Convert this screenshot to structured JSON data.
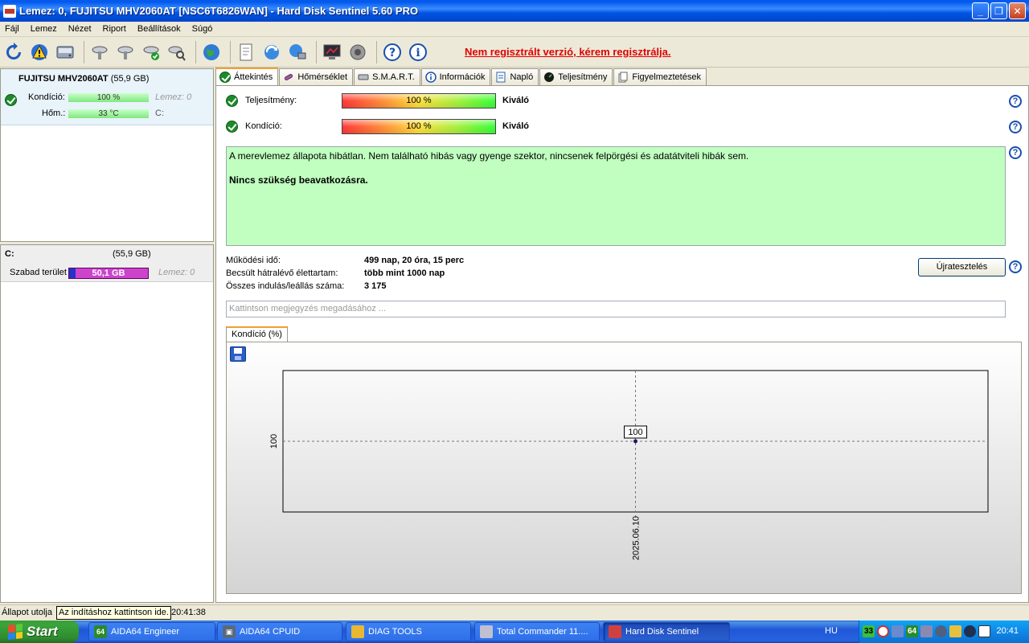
{
  "window": {
    "title": "Lemez: 0, FUJITSU MHV2060AT [NSC6T6826WAN]  -  Hard Disk Sentinel 5.60 PRO",
    "min": "_",
    "max": "❐",
    "close": "✕"
  },
  "menu": [
    "Fájl",
    "Lemez",
    "Nézet",
    "Riport",
    "Beállítások",
    "Súgó"
  ],
  "toolbar": {
    "icons": [
      "refresh-icon",
      "alert-icon",
      "disk-icon",
      "disk-test-icon",
      "disk-surface-icon",
      "disk-ok-icon",
      "disk-search-icon",
      "globe-icon",
      "report-icon",
      "update-icon",
      "network-icon",
      "monitor-icon",
      "speaker-icon",
      "help-icon",
      "info-icon"
    ],
    "unregistered": "Nem regisztrált verzió, kérem regisztrálja."
  },
  "disk": {
    "name": "FUJITSU MHV2060AT",
    "size": "(55,9 GB)",
    "condition_label": "Kondíció:",
    "condition_value": "100 %",
    "condition_pct": 100,
    "disk_label": "Lemez: 0",
    "temp_label": "Hőm.:",
    "temp_value": "33 °C",
    "drive": "C:"
  },
  "volume": {
    "name": "C:",
    "size": "(55,9 GB)",
    "free_label": "Szabad terület",
    "free_value": "50,1 GB",
    "disk_label": "Lemez: 0"
  },
  "tabs": [
    {
      "label": "Áttekintés",
      "icon": "ok-icon",
      "active": true
    },
    {
      "label": "Hőmérséklet",
      "icon": "thermometer-icon",
      "active": false
    },
    {
      "label": "S.M.A.R.T.",
      "icon": "smart-icon",
      "active": false
    },
    {
      "label": "Információk",
      "icon": "info-icon",
      "active": false
    },
    {
      "label": "Napló",
      "icon": "log-icon",
      "active": false
    },
    {
      "label": "Teljesítmény",
      "icon": "performance-icon",
      "active": false
    },
    {
      "label": "Figyelmeztetések",
      "icon": "warnings-icon",
      "active": false
    }
  ],
  "overview": {
    "performance_label": "Teljesítmény:",
    "performance_value": "100 %",
    "performance_verdict": "Kiváló",
    "health_label": "Kondíció:",
    "health_value": "100 %",
    "health_verdict": "Kiváló",
    "status_text": "A merevlemez állapota hibátlan. Nem található hibás vagy gyenge szektor, nincsenek felpörgési és adatátviteli hibák sem.",
    "status_action": "Nincs szükség beavatkozásra.",
    "help_symbol": "?",
    "power_on_label": "Működési idő:",
    "power_on_value": "499 nap, 20 óra, 15 perc",
    "lifetime_label": "Becsült hátralévő élettartam:",
    "lifetime_value": "több mint 1000 nap",
    "starts_label": "Összes indulás/leállás száma:",
    "starts_value": "3 175",
    "retest_button": "Újratesztelés",
    "note_placeholder": "Kattintson megjegyzés megadásához ..."
  },
  "chart_tab": "Kondíció  (%)",
  "chart_data": {
    "type": "line",
    "x": [
      "2025.06.10"
    ],
    "values": [
      100
    ],
    "title": "",
    "xlabel": "",
    "ylabel": "",
    "y_tick": "100",
    "point_label": "100",
    "grid": true
  },
  "statusbar": {
    "prefix": "Állapot utolja",
    "tooltip": "Az indításhoz kattintson ide.",
    "time": "20:41:38"
  },
  "taskbar": {
    "start": "Start",
    "tasks": [
      {
        "label": "AIDA64 Engineer",
        "icon": "64",
        "color": "#2a8a2a"
      },
      {
        "label": "AIDA64 CPUID",
        "icon": "▣",
        "color": "#5a6a7a"
      },
      {
        "label": "DIAG TOOLS",
        "icon": "▰",
        "color": "#e8b830"
      },
      {
        "label": "Total Commander 11....",
        "icon": "▤",
        "color": "#c0c0d0"
      },
      {
        "label": "Hard Disk Sentinel",
        "icon": "▬",
        "color": "#d04040"
      }
    ],
    "lang": "HU",
    "tray_temp": "33",
    "tray_aida": "64",
    "clock": "20:41"
  }
}
